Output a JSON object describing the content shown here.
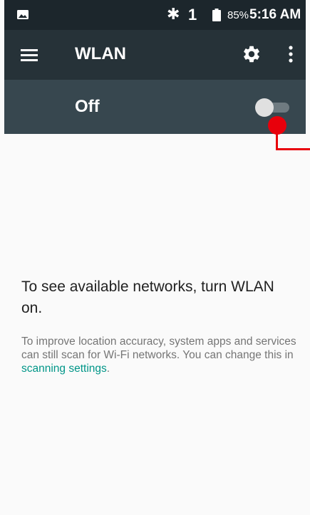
{
  "status_bar": {
    "bluetooth_glyph": "✱",
    "sim_indicator": "1",
    "battery_percent": "85%",
    "time": "5:16 AM",
    "icons": [
      "picture-notification-icon",
      "bluetooth-icon",
      "battery-icon"
    ]
  },
  "toolbar": {
    "title": "WLAN",
    "icons": [
      "menu-icon",
      "gear-icon",
      "overflow-menu-icon"
    ]
  },
  "wlan_switch": {
    "state_label": "Off",
    "enabled": false
  },
  "empty_state": {
    "heading": "To see available networks, turn WLAN on.",
    "body_prefix": "To improve location accuracy, system apps and services can still scan for Wi-Fi networks. You can change this in ",
    "link_text": "scanning settings",
    "body_suffix": "."
  },
  "colors": {
    "status_bar_bg": "#1c262c",
    "toolbar_bg": "#263238",
    "switch_bar_bg": "#37474f",
    "link": "#009688",
    "annotation": "#e8000b"
  }
}
